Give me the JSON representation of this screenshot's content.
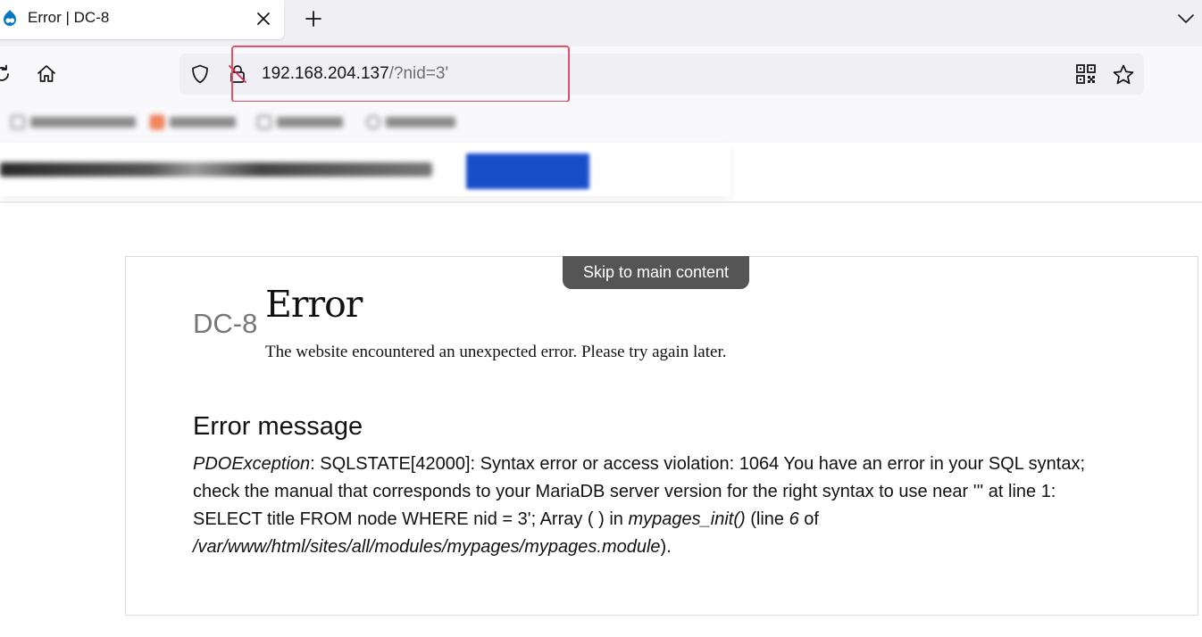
{
  "tab": {
    "title": "Error | DC-8",
    "favicon_icon": "drupal-icon",
    "close_icon": "close-icon"
  },
  "toolbar": {
    "new_tab_icon": "plus-icon",
    "list_all_tabs_icon": "chevron-down-icon",
    "reload_icon": "reload-icon",
    "home_icon": "home-icon"
  },
  "urlbar": {
    "url_host": "192.168.204.137",
    "url_path": "/?nid=3'",
    "tracking_icon": "shield-icon",
    "security_icon": "insecure-lock-icon",
    "qr_icon": "qr-code-icon",
    "bookmark_icon": "star-icon",
    "highlight_color": "#e84e66"
  },
  "page": {
    "skip_link": "Skip to main content",
    "site_name": "DC-8",
    "heading": "Error",
    "intro": "The website encountered an unexpected error. Please try again later.",
    "error_heading": "Error message",
    "error": {
      "exception": "PDOException",
      "message": ": SQLSTATE[42000]: Syntax error or access violation: 1064 You have an error in your SQL syntax; check the manual that corresponds to your MariaDB server version for the right syntax to use near ''' at line 1: SELECT title FROM node WHERE nid = 3'; Array ( ) in ",
      "function": "mypages_init()",
      "line_prefix": " (line ",
      "line": "6",
      "of": " of ",
      "file": "/var/www/html/sites/all/modules/mypages/mypages.module",
      "suffix": ")."
    }
  }
}
